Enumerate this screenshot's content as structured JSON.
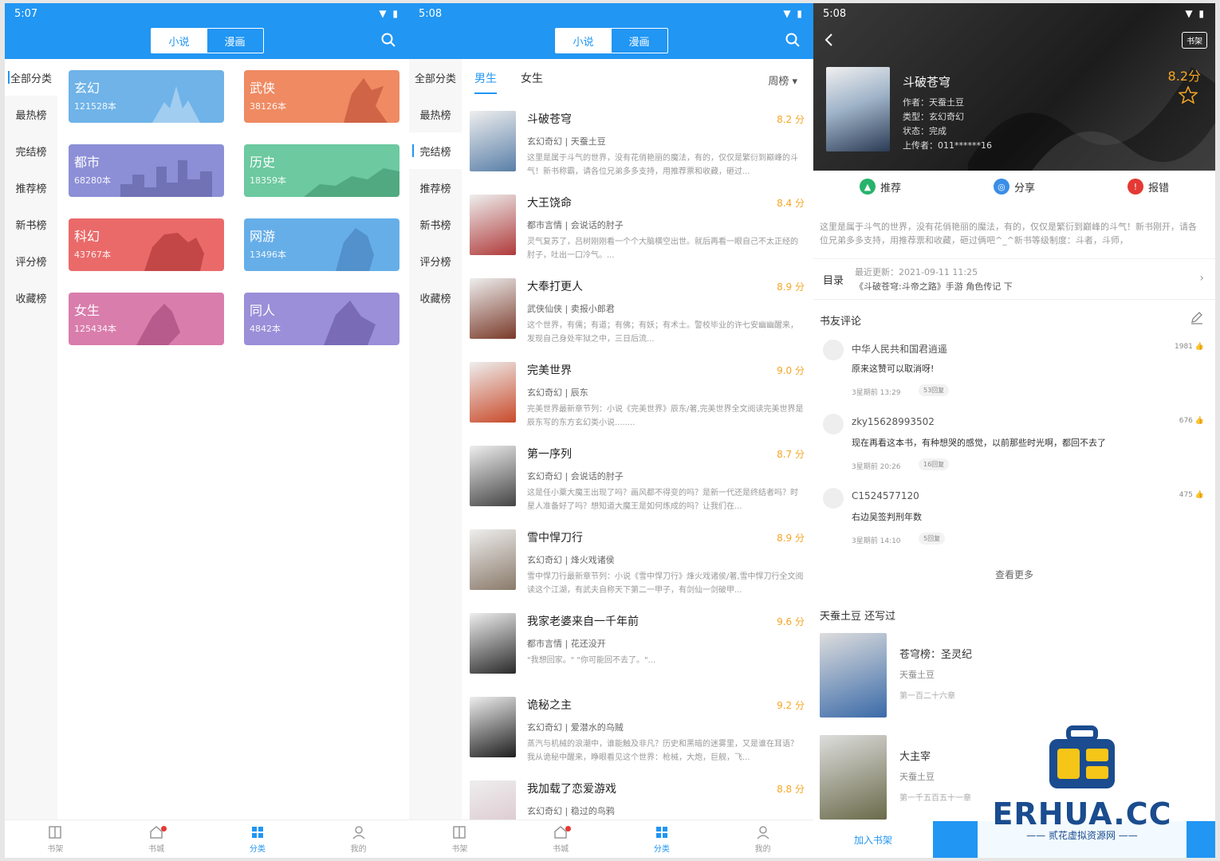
{
  "phone1": {
    "time": "5:07",
    "seg": {
      "novel": "小说",
      "comic": "漫画"
    },
    "nav": [
      "全部分类",
      "最热榜",
      "完结榜",
      "推荐榜",
      "新书榜",
      "评分榜",
      "收藏榜"
    ],
    "cards": [
      {
        "name": "玄幻",
        "count": "121528本",
        "color": "#6fb3e8"
      },
      {
        "name": "武侠",
        "count": "38126本",
        "color": "#ef8a62"
      },
      {
        "name": "都市",
        "count": "68280本",
        "color": "#8c8fd6"
      },
      {
        "name": "历史",
        "count": "18359本",
        "color": "#6cc9a0"
      },
      {
        "name": "科幻",
        "count": "43767本",
        "color": "#ea6a6a"
      },
      {
        "name": "网游",
        "count": "13496本",
        "color": "#66aee8"
      },
      {
        "name": "女生",
        "count": "125434本",
        "color": "#d97dac"
      },
      {
        "name": "同人",
        "count": "4842本",
        "color": "#9a8fd8"
      }
    ]
  },
  "tabbar": {
    "shelf": "书架",
    "city": "书城",
    "category": "分类",
    "mine": "我的"
  },
  "phone2": {
    "time": "5:08",
    "seg": {
      "novel": "小说",
      "comic": "漫画"
    },
    "nav": [
      "全部分类",
      "最热榜",
      "完结榜",
      "推荐榜",
      "新书榜",
      "评分榜",
      "收藏榜"
    ],
    "gender": {
      "male": "男生",
      "female": "女生"
    },
    "rank": "周榜",
    "books": [
      {
        "title": "斗破苍穹",
        "score": "8.2 分",
        "meta": "玄幻奇幻 | 天蚕土豆",
        "desc": "这里是属于斗气的世界，没有花俏艳丽的魔法，有的，仅仅是繁衍到巅峰的斗气！新书称霸，请各位兄弟多多支持，用推荐票和收藏，砸过...",
        "color": "#5a7fa8"
      },
      {
        "title": "大王饶命",
        "score": "8.4 分",
        "meta": "都市言情 | 会说话的肘子",
        "desc": "灵气复苏了，吕树刚刚看一个个大脑横空出世。就后再看一眼自己不太正经的肘子，吐出一口冷气。...",
        "color": "#b03a3a"
      },
      {
        "title": "大奉打更人",
        "score": "8.9 分",
        "meta": "武侠仙侠 | 卖报小郎君",
        "desc": "这个世界，有儒；有道；有佛；有妖；有术士。警校毕业的许七安幽幽醒来，发现自己身处牢狱之中，三日后流...",
        "color": "#7a3a2a"
      },
      {
        "title": "完美世界",
        "score": "9.0 分",
        "meta": "玄幻奇幻 | 辰东",
        "desc": "完美世界最新章节列：小说《完美世界》辰东/著,完美世界全文阅读完美世界是辰东写的东方玄幻类小说........",
        "color": "#c94a2a"
      },
      {
        "title": "第一序列",
        "score": "8.7 分",
        "meta": "玄幻奇幻 | 会说话的肘子",
        "desc": "这是任小粟大魔王出现了吗？画风都不得变的吗？是新一代还是终结者吗？时星人准备好了吗？想知道大魔王是如何炼成的吗？让我们在...",
        "color": "#444444"
      },
      {
        "title": "雪中悍刀行",
        "score": "8.9 分",
        "meta": "玄幻奇幻 | 烽火戏诸侯",
        "desc": "雪中悍刀行最新章节列：小说《雪中悍刀行》烽火戏诸侯/著,雪中悍刀行全文阅读这个江湖，有武夫自称天下第二一甲子，有剑仙一剑破甲...",
        "color": "#8a7a6a"
      },
      {
        "title": "我家老婆来自一千年前",
        "score": "9.6 分",
        "meta": "都市言情 | 花还没开",
        "desc": "\"我想回家。\" \"你可能回不去了。\"...",
        "color": "#2a2a2a"
      },
      {
        "title": "诡秘之主",
        "score": "9.2 分",
        "meta": "玄幻奇幻 | 爱潜水的乌贼",
        "desc": "蒸汽与机械的浪潮中，谁能触及非凡？历史和黑暗的迷雾里，又是谁在耳语？我从诡秘中醒来，睁眼看见这个世界：枪械，大炮，巨舰，飞...",
        "color": "#1e1e1e"
      },
      {
        "title": "我加载了恋爱游戏",
        "score": "8.8 分",
        "meta": "玄幻奇幻 | 稳过的鸟鸦",
        "desc": "",
        "color": "#d8c0c8"
      }
    ]
  },
  "phone3": {
    "time": "5:08",
    "shelf_btn": "书架",
    "title": "斗破苍穹",
    "author": "作者：天蚕土豆",
    "genre": "类型：玄幻奇幻",
    "status": "状态：完成",
    "uploader": "上传者：011******16",
    "score": "8.2分",
    "actions": {
      "recommend": "推荐",
      "share": "分享",
      "report": "报错"
    },
    "intro": "这里是属于斗气的世界，没有花俏艳丽的魔法，有的，仅仅是繁衍到巅峰的斗气！新书刚开，请各位兄弟多多支持，用推荐票和收藏，砸过俩吧^_^新书等级制度：斗者，斗师，",
    "toc": {
      "label": "目录",
      "updated": "最近更新：2021-09-11 11:25",
      "chapter": "《斗破苍穹:斗帝之路》手游 角色传记 下"
    },
    "comments_title": "书友评论",
    "comments": [
      {
        "user": "中华人民共和国君逍遥",
        "likes": "1981",
        "text": "原来这赞可以取消呀!",
        "time": "3星期前 13:29",
        "replies": "53回复"
      },
      {
        "user": "zky15628993502",
        "likes": "676",
        "text": "现在再看这本书，有种想哭的感觉，以前那些时光啊，都回不去了",
        "time": "3星期前 20:26",
        "replies": "16回复"
      },
      {
        "user": "C1524577120",
        "likes": "475",
        "text": "右边吴签判刑年数",
        "time": "3星期前 14:10",
        "replies": "5回复"
      }
    ],
    "see_more": "查看更多",
    "also_wrote": "天蚕土豆  还写过",
    "other_books": [
      {
        "title": "苍穹榜：圣灵纪",
        "author": "天蚕土豆",
        "chapter": "第一百二十六章",
        "color": "#3a6aa8"
      },
      {
        "title": "大主宰",
        "author": "天蚕土豆",
        "chapter": "第一千五百五十一章",
        "color": "#6a6a4a"
      }
    ],
    "add_shelf": "加入书架"
  },
  "watermark": {
    "brand": "ERHUA.CC",
    "sub": "—— 贰花虚拟资源网 ——"
  }
}
